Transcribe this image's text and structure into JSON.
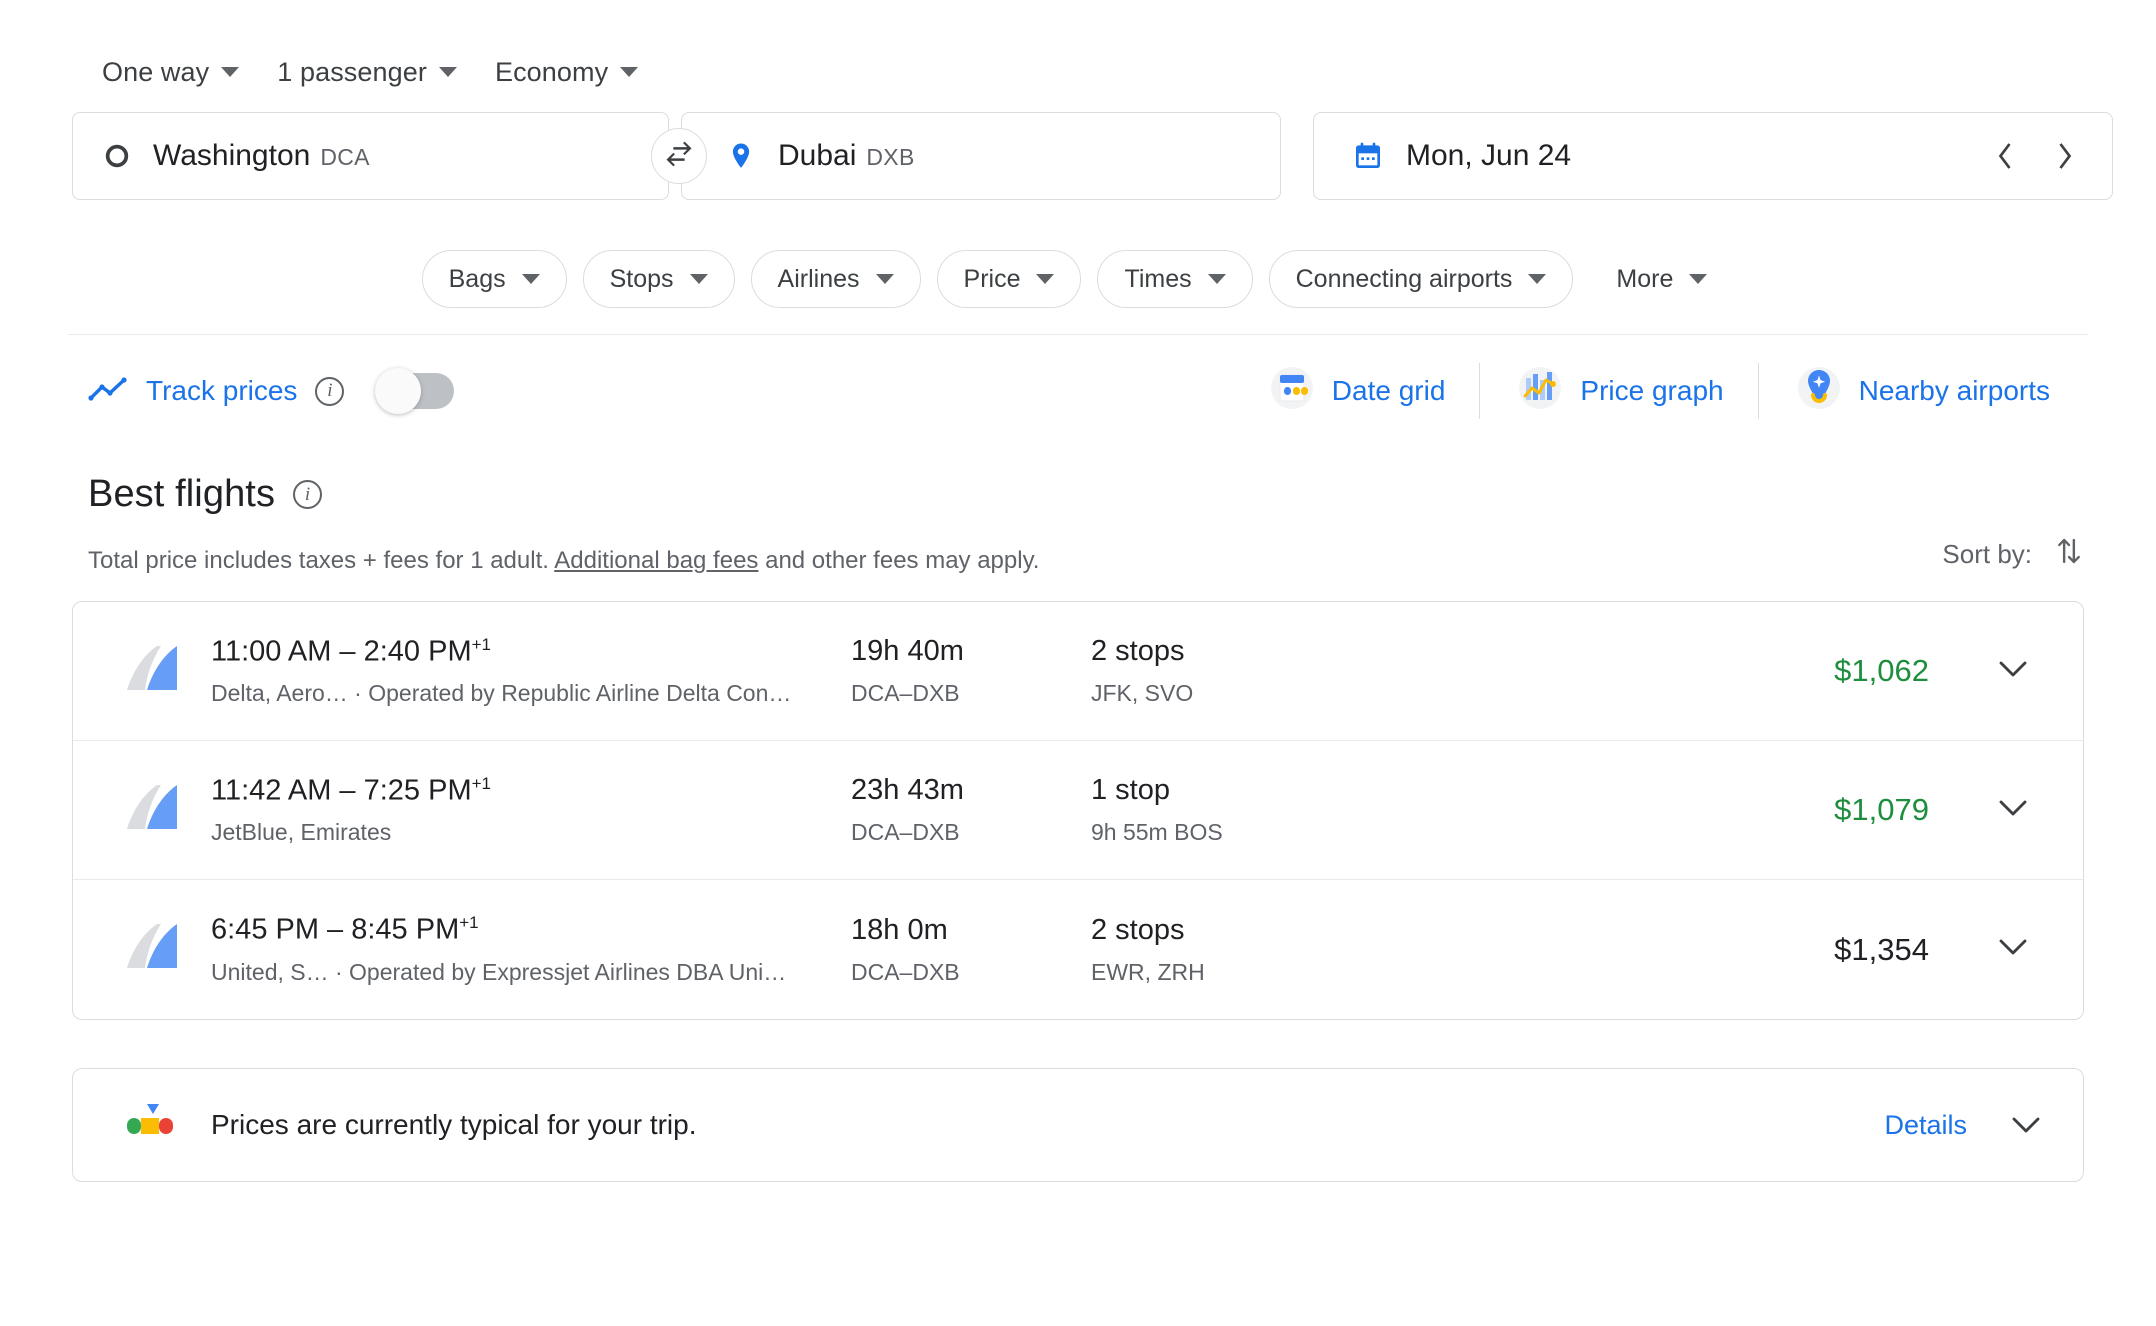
{
  "search_options": [
    {
      "label": "One way",
      "name": "trip-type"
    },
    {
      "label": "1 passenger",
      "name": "passengers"
    },
    {
      "label": "Economy",
      "name": "cabin-class"
    }
  ],
  "search_form": {
    "origin": {
      "city": "Washington",
      "code": "DCA",
      "icon": "circle-outline-icon"
    },
    "destination": {
      "city": "Dubai",
      "code": "DXB",
      "icon": "location-pin-icon"
    },
    "swap_icon": "swap-horizontal-icon",
    "date": {
      "value": "Mon, Jun 24",
      "icon": "calendar-icon"
    },
    "prev_day_icon": "chevron-left-icon",
    "next_day_icon": "chevron-right-icon"
  },
  "filters": [
    {
      "label": "Bags",
      "pill": true
    },
    {
      "label": "Stops",
      "pill": true
    },
    {
      "label": "Airlines",
      "pill": true
    },
    {
      "label": "Price",
      "pill": true
    },
    {
      "label": "Times",
      "pill": true
    },
    {
      "label": "Connecting airports",
      "pill": true
    },
    {
      "label": "More",
      "pill": false
    }
  ],
  "tools": {
    "track_prices": {
      "label": "Track prices",
      "icon": "trending-line-icon",
      "info_icon": "info-icon",
      "toggle_state": "off"
    },
    "links": [
      {
        "label": "Date grid",
        "icon": "date-grid-icon"
      },
      {
        "label": "Price graph",
        "icon": "price-graph-icon"
      },
      {
        "label": "Nearby airports",
        "icon": "nearby-airports-icon"
      }
    ]
  },
  "best_flights": {
    "title": "Best flights",
    "info_icon": "info-icon",
    "subtitle_before": "Total price includes taxes + fees for 1 adult. ",
    "subtitle_link": "Additional bag fees",
    "subtitle_after": " and other fees may apply.",
    "sort_label": "Sort by:",
    "sort_icon": "sort-arrows-icon",
    "rows": [
      {
        "times": "11:00 AM – 2:40 PM",
        "day_offset": "+1",
        "airlines": "Delta, Aero… · Operated by Republic Airline Delta Con…",
        "duration": "19h 40m",
        "route": "DCA–DXB",
        "stops": "2 stops",
        "stop_detail": "JFK, SVO",
        "price": "$1,062",
        "price_style": "cheap",
        "logo": "airline-tail-logo",
        "expand_icon": "chevron-down-icon"
      },
      {
        "times": "11:42 AM – 7:25 PM",
        "day_offset": "+1",
        "airlines": "JetBlue, Emirates",
        "duration": "23h 43m",
        "route": "DCA–DXB",
        "stops": "1 stop",
        "stop_detail": "9h 55m BOS",
        "price": "$1,079",
        "price_style": "cheap",
        "logo": "airline-tail-logo",
        "expand_icon": "chevron-down-icon"
      },
      {
        "times": "6:45 PM – 8:45 PM",
        "day_offset": "+1",
        "airlines": "United, S…  · Operated by Expressjet Airlines DBA Uni…",
        "duration": "18h 0m",
        "route": "DCA–DXB",
        "stops": "2 stops",
        "stop_detail": "EWR, ZRH",
        "price": "$1,354",
        "price_style": "normal",
        "logo": "airline-tail-logo",
        "expand_icon": "chevron-down-icon"
      }
    ]
  },
  "price_insight": {
    "icon": "price-gauge-icon",
    "text": "Prices are currently typical for your trip.",
    "details_label": "Details",
    "expand_icon": "chevron-down-icon"
  },
  "colors": {
    "accent_blue": "#1a73e8",
    "cheap_green": "#1e8e3e",
    "text_primary": "#202124",
    "text_secondary": "#5f6368",
    "border": "#dadce0"
  }
}
